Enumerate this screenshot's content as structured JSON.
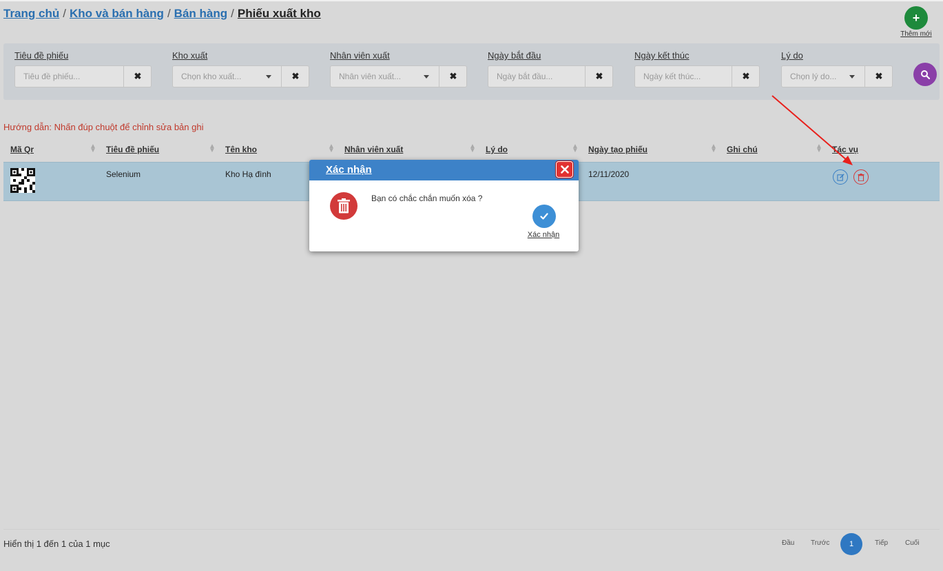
{
  "breadcrumb": {
    "home": "Trang chủ",
    "warehouse": "Kho và bán hàng",
    "sales": "Bán hàng",
    "current": "Phiếu xuất kho",
    "separator": "/"
  },
  "add_button": {
    "icon": "+",
    "label": "Thêm mới"
  },
  "filters": {
    "title": {
      "label": "Tiêu đề phiếu",
      "placeholder": "Tiêu đề phiếu..."
    },
    "warehouse": {
      "label": "Kho xuất",
      "placeholder": "Chọn kho xuất..."
    },
    "employee": {
      "label": "Nhân viên xuất",
      "placeholder": "Nhân viên xuất..."
    },
    "start_date": {
      "label": "Ngày bắt đầu",
      "placeholder": "Ngày bắt đầu..."
    },
    "end_date": {
      "label": "Ngày kết thúc",
      "placeholder": "Ngày kết thúc..."
    },
    "reason": {
      "label": "Lý do",
      "placeholder": "Chọn lý do..."
    },
    "clear_icon": "✖"
  },
  "hint": "Hướng dẫn: Nhấn đúp chuột để chỉnh sửa bản ghi",
  "table": {
    "columns": [
      "Mã Qr",
      "Tiêu đề phiếu",
      "Tên kho",
      "Nhân viên xuất",
      "Lý do",
      "Ngày tạo phiếu",
      "Ghi chú",
      "Tác vụ"
    ],
    "rows": [
      {
        "qr": "qr-code-image",
        "title": "Selenium",
        "warehouse": "Kho Hạ đình",
        "employee": "",
        "reason": "",
        "created": "12/11/2020",
        "note": ""
      }
    ]
  },
  "footer": {
    "info": "Hiển thị 1 đến 1 của 1 mục",
    "first": "Đầu",
    "prev": "Trước",
    "current_page": "1",
    "next": "Tiếp",
    "last": "Cuối"
  },
  "modal": {
    "title": "Xác nhận",
    "message": "Bạn có chắc chắn muốn xóa ?",
    "confirm_label": "Xác nhận"
  },
  "colors": {
    "accent_blue": "#3d82c8",
    "danger_red": "#d23a3a",
    "add_green": "#1e8a3c",
    "search_purple": "#8a3fa8",
    "row_highlight": "#a9c5d4"
  }
}
